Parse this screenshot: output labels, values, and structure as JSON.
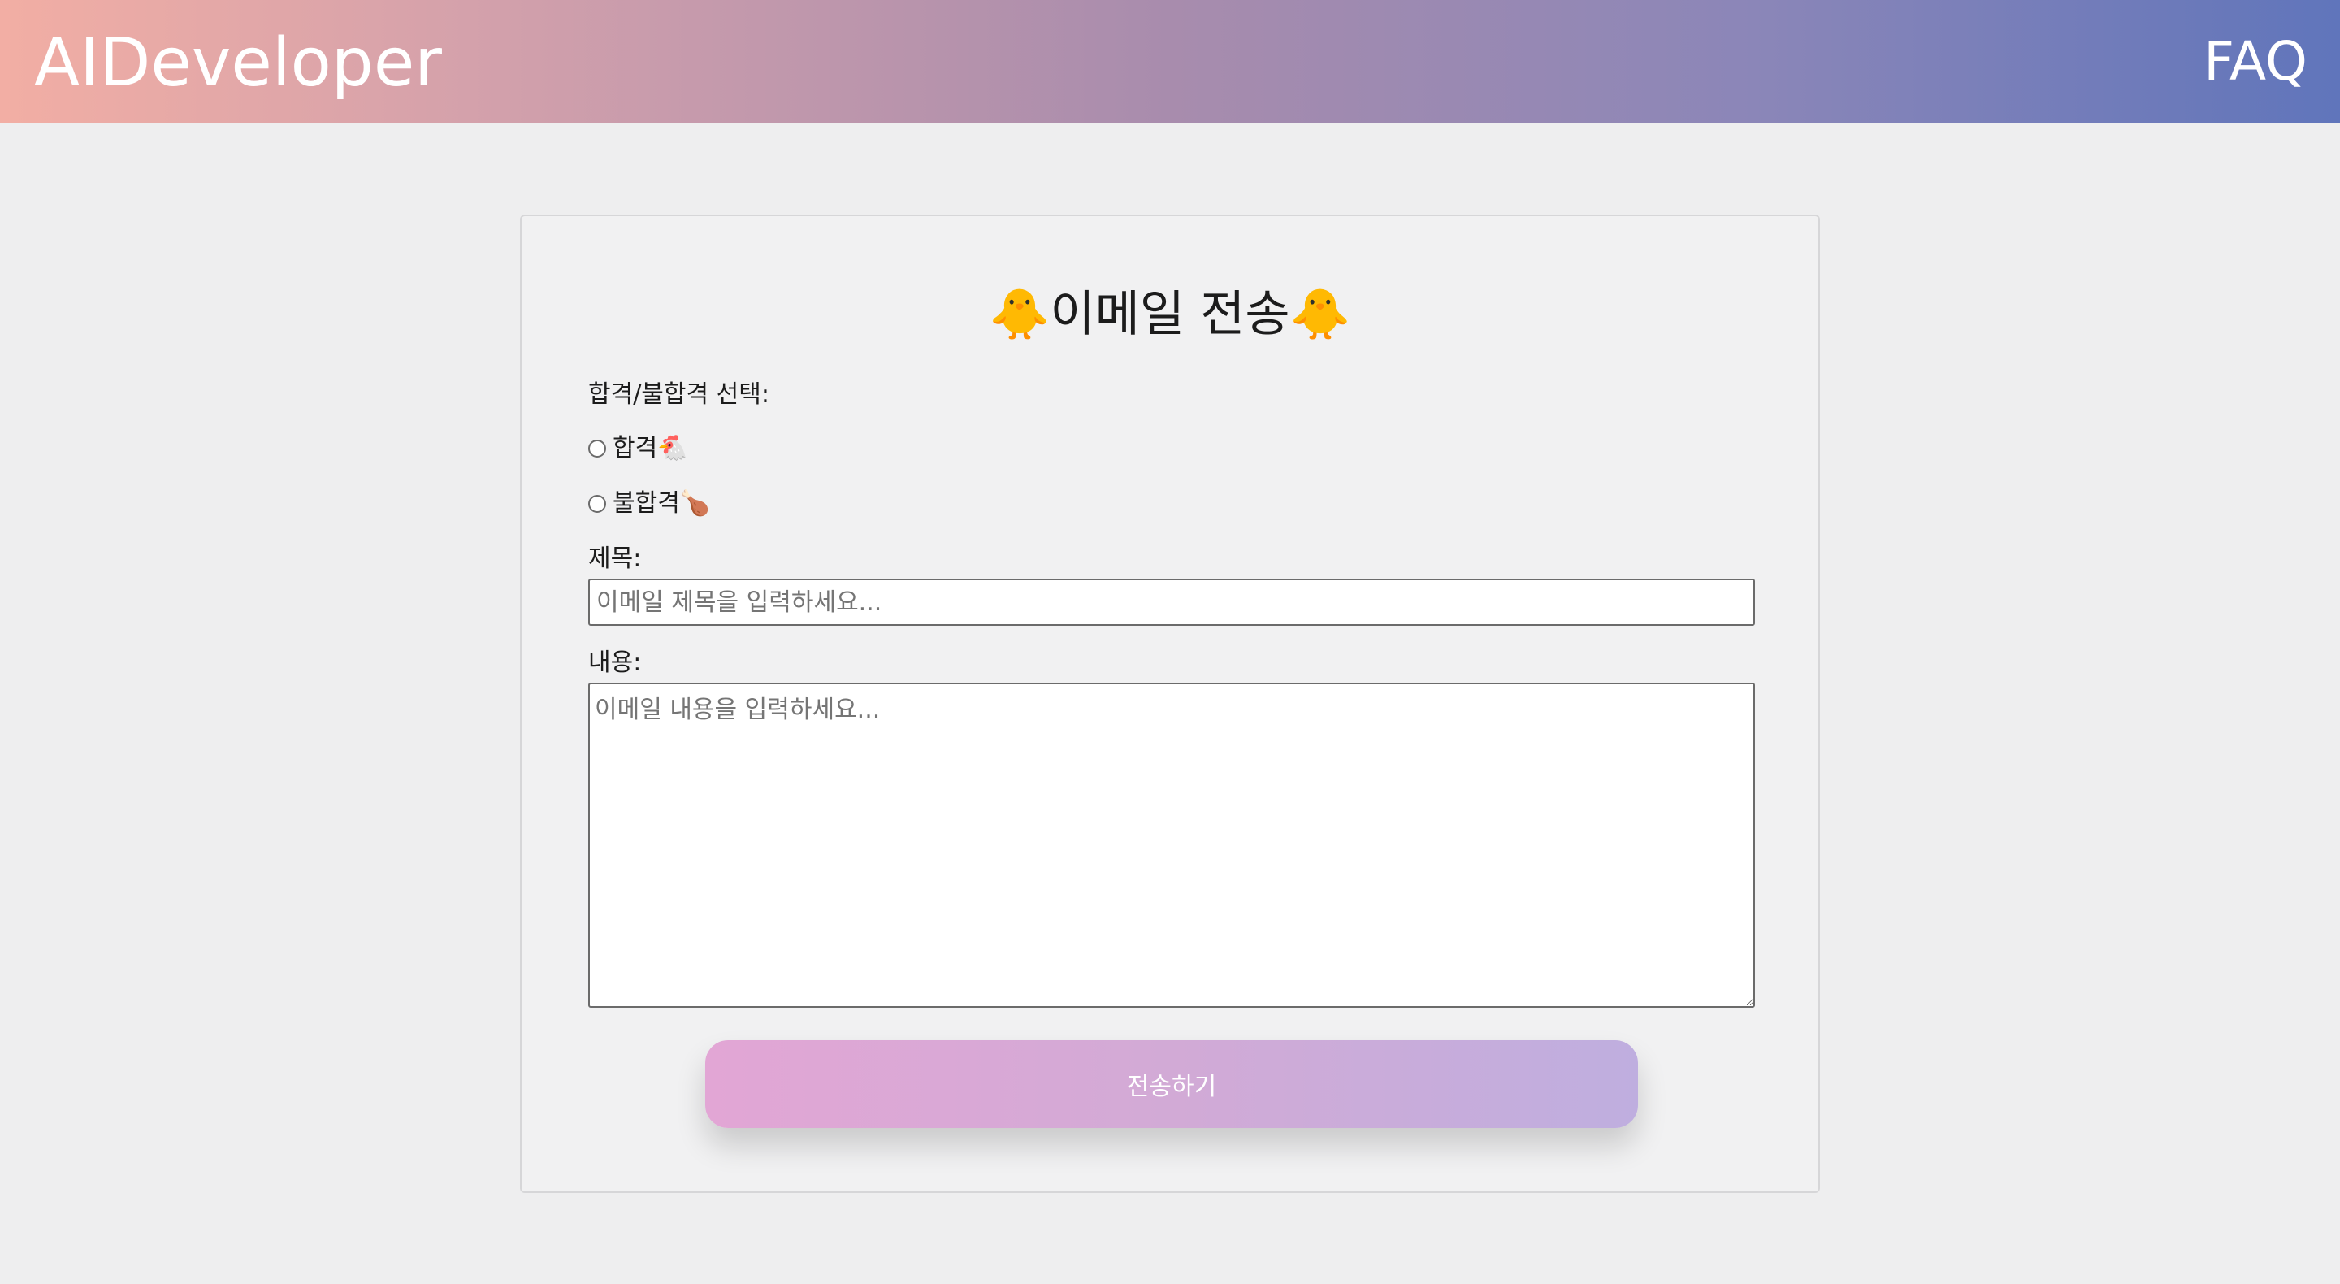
{
  "header": {
    "logo": "AIDeveloper",
    "nav_faq": "FAQ"
  },
  "form": {
    "title": "🐥이메일 전송🐥",
    "selection_label": "합격/불합격 선택:",
    "options": [
      {
        "label": "합격🐔"
      },
      {
        "label": "불합격🍗"
      }
    ],
    "subject_label": "제목:",
    "subject_placeholder": "이메일 제목을 입력하세요...",
    "content_label": "내용:",
    "content_placeholder": "이메일 내용을 입력하세요...",
    "submit_label": "전송하기"
  },
  "colors": {
    "header_gradient_start": "#f2aea4",
    "header_gradient_end": "#6075bb",
    "button_gradient_start": "#e2a6d5",
    "button_gradient_end": "#bfaedf"
  }
}
